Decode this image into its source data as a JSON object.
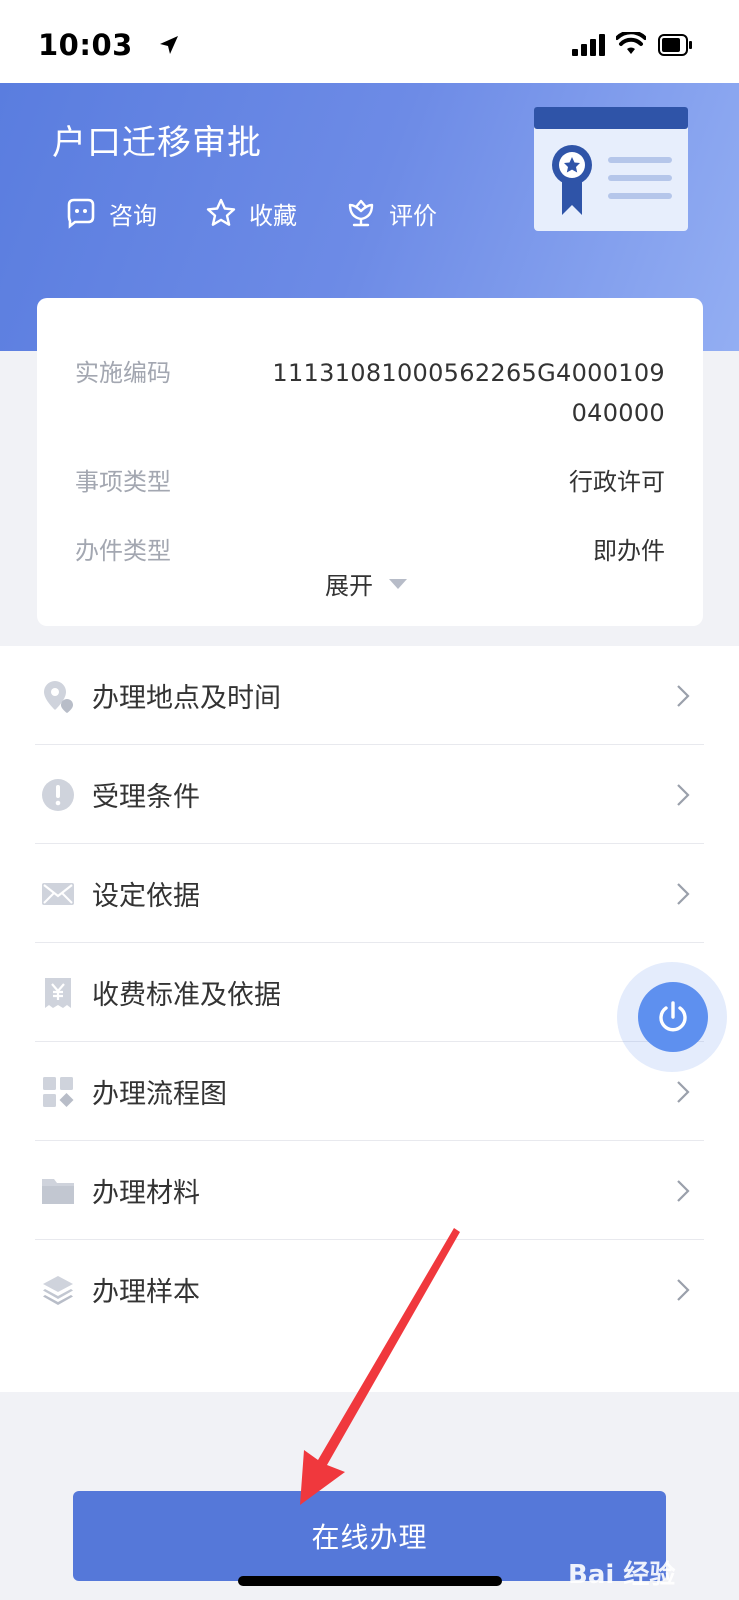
{
  "status_bar": {
    "time": "10:03"
  },
  "header": {
    "title": "户口迁移审批",
    "actions": {
      "consult": "咨询",
      "favorite": "收藏",
      "rate": "评价"
    }
  },
  "info": {
    "code_label": "实施编码",
    "code_value": "11131081000562265G4000109040000",
    "type_label": "事项类型",
    "type_value": "行政许可",
    "handle_label": "办件类型",
    "handle_value": "即办件",
    "expand": "展开"
  },
  "list": [
    {
      "label": "办理地点及时间",
      "icon": "location-icon"
    },
    {
      "label": "受理条件",
      "icon": "alert-icon"
    },
    {
      "label": "设定依据",
      "icon": "mail-icon"
    },
    {
      "label": "收费标准及依据",
      "icon": "fee-icon"
    },
    {
      "label": "办理流程图",
      "icon": "grid-icon"
    },
    {
      "label": "办理材料",
      "icon": "folder-icon"
    },
    {
      "label": "办理样本",
      "icon": "layers-icon"
    }
  ],
  "submit": "在线办理",
  "watermark": "Bai 经验",
  "colors": {
    "accent": "#5578d9",
    "header_start": "#5a7ddf",
    "header_end": "#93aef3",
    "annotation_arrow": "#f0383d"
  }
}
